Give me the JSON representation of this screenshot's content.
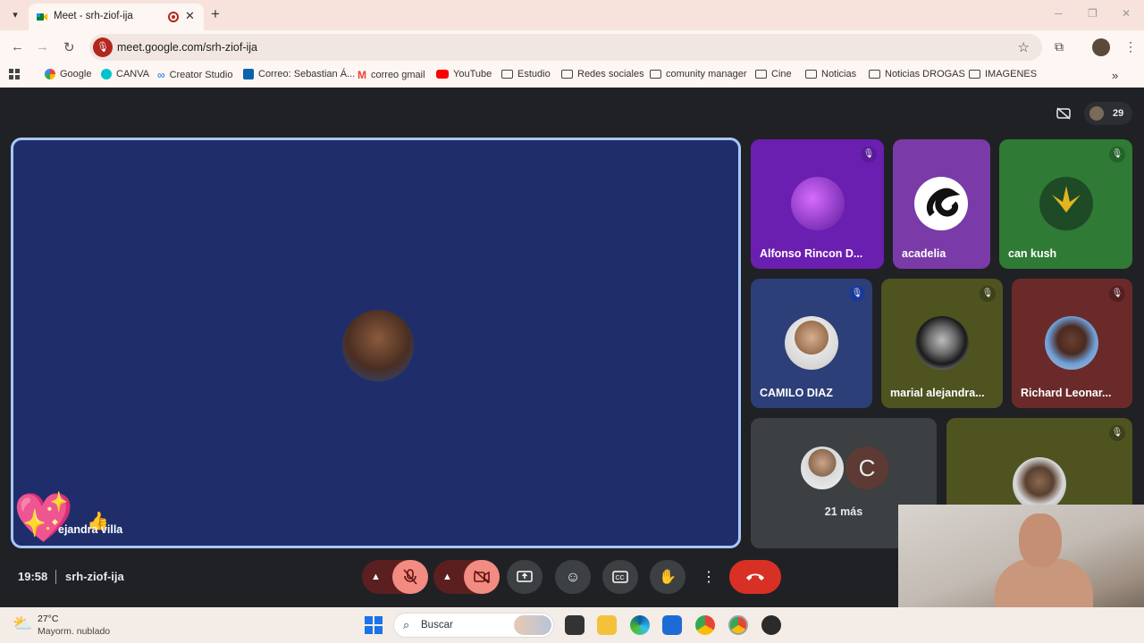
{
  "browser": {
    "tab_title": "Meet - srh-ziof-ija",
    "url": "meet.google.com/srh-ziof-ija",
    "bookmarks": [
      {
        "label": "Google",
        "icon": "google-icon"
      },
      {
        "label": "CANVA",
        "icon": "canva-icon"
      },
      {
        "label": "Creator Studio",
        "icon": "meta-icon"
      },
      {
        "label": "Correo: Sebastian Á...",
        "icon": "outlook-icon"
      },
      {
        "label": "correo gmail",
        "icon": "gmail-icon"
      },
      {
        "label": "YouTube",
        "icon": "youtube-icon"
      },
      {
        "label": "Estudio",
        "icon": "folder-icon"
      },
      {
        "label": "Redes sociales",
        "icon": "folder-icon"
      },
      {
        "label": "comunity manager",
        "icon": "folder-icon"
      },
      {
        "label": "Cine",
        "icon": "folder-icon"
      },
      {
        "label": "Noticias",
        "icon": "folder-icon"
      },
      {
        "label": "Noticias DROGAS",
        "icon": "folder-icon"
      },
      {
        "label": "IMAGENES",
        "icon": "folder-icon"
      }
    ]
  },
  "meet": {
    "participant_count": "29",
    "main_speaker": {
      "name": "alejandra villa",
      "visible_name": "ejandra villa"
    },
    "tiles": [
      {
        "name": "Alfonso Rincon D...",
        "color": "#6a1fb0",
        "muted": true
      },
      {
        "name": "acadelia",
        "color": "#7a3aa8",
        "muted": false
      },
      {
        "name": "can kush",
        "color": "#2f7a35",
        "muted": true
      },
      {
        "name": "CAMILO DIAZ",
        "color": "#2d3f78",
        "muted": true
      },
      {
        "name": "marial alejandra...",
        "color": "#4e5320",
        "muted": true
      },
      {
        "name": "Richard Leonar...",
        "color": "#6b2a2a",
        "muted": true
      }
    ],
    "more_label": "21 más",
    "more_initial": "C",
    "meeting_time": "19:58",
    "meeting_code": "srh-ziof-ija"
  },
  "taskbar": {
    "temperature": "27°C",
    "weather": "Mayorm. nublado",
    "search_placeholder": "Buscar"
  },
  "colors": {
    "active_speaker_border": "#a8c7fa",
    "end_call": "#d93025",
    "muted_button": "#f28b82"
  }
}
